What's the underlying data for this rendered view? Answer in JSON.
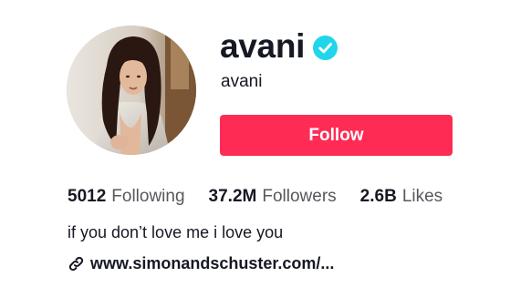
{
  "profile": {
    "username": "avani",
    "nickname": "avani",
    "verified": true,
    "verified_icon": "verified-check-icon",
    "avatar_icon": "profile-photo"
  },
  "actions": {
    "follow_label": "Follow"
  },
  "stats": {
    "following_count": "5012",
    "following_label": "Following",
    "followers_count": "37.2M",
    "followers_label": "Followers",
    "likes_count": "2.6B",
    "likes_label": "Likes"
  },
  "bio": {
    "text": "if you don’t love me i love you"
  },
  "link": {
    "icon": "link-icon",
    "text": "www.simonandschuster.com/..."
  },
  "colors": {
    "follow_button": "#fe2c55",
    "verified_badge": "#20d5ec",
    "text_primary": "#161823",
    "text_secondary": "#57585d"
  }
}
